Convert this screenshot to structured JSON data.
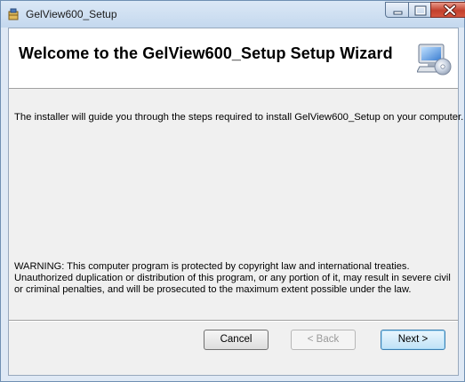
{
  "window": {
    "title": "GelView600_Setup",
    "controls": {
      "minimize": "minimize-icon",
      "maximize": "maximize-icon",
      "close": "close-icon"
    }
  },
  "banner": {
    "title": "Welcome to the GelView600_Setup Setup Wizard",
    "icon": "computer-cd-icon"
  },
  "body": {
    "intro": "The installer will guide you through the steps required to install GelView600_Setup on your computer.",
    "warning": "WARNING: This computer program is protected by copyright law and international treaties. Unauthorized duplication or distribution of this program, or any portion of it, may result in severe civil or criminal penalties, and will be prosecuted to the maximum extent possible under the law."
  },
  "buttons": {
    "cancel": "Cancel",
    "back": "< Back",
    "next": "Next >"
  },
  "colors": {
    "title_bar": "#c4d8ee",
    "close_button": "#c2402d",
    "dialog_background": "#f0f0f0"
  }
}
